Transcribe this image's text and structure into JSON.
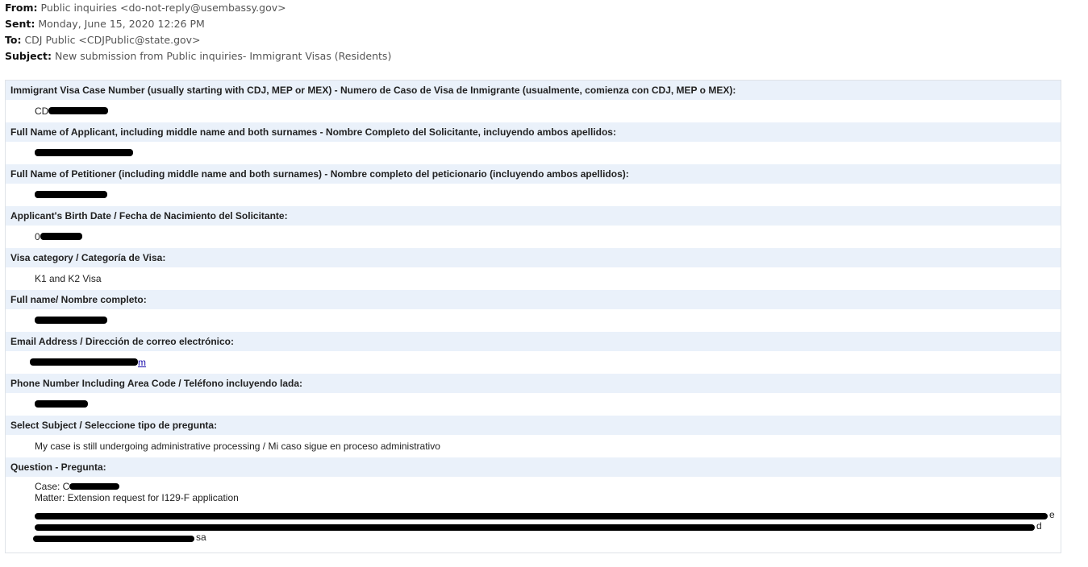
{
  "email_header": {
    "from_label": "From:",
    "from_value": "Public inquiries <do-not-reply@usembassy.gov>",
    "sent_label": "Sent:",
    "sent_value": "Monday, June 15, 2020 12:26 PM",
    "to_label": "To:",
    "to_value": "CDJ Public <CDJPublic@state.gov>",
    "subject_label": "Subject:",
    "subject_value": "New submission from Public inquiries- Immigrant Visas (Residents)"
  },
  "form": {
    "fields": [
      {
        "label": "Immigrant Visa Case Number (usually starting with CDJ, MEP or MEX) - Numero de Caso de Visa de Inmigrante (usualmente, comienza con CDJ, MEP o MEX):",
        "value_visible": "CD"
      },
      {
        "label": "Full Name of Applicant, including middle name and both surnames - Nombre Completo del Solicitante, incluyendo ambos apellidos:",
        "value_visible": ""
      },
      {
        "label": "Full Name of Petitioner (including middle name and both surnames) - Nombre completo del peticionario (incluyendo ambos apellidos):",
        "value_visible": ""
      },
      {
        "label": "Applicant's Birth Date / Fecha de Nacimiento del Solicitante:",
        "value_visible": "0"
      },
      {
        "label": "Visa category / Categoría de Visa:",
        "value_visible": "K1 and K2 Visa"
      },
      {
        "label": "Full name/ Nombre completo:",
        "value_visible": ""
      },
      {
        "label": "Email Address / Dirección de correo electrónico:",
        "value_visible": "m"
      },
      {
        "label": "Phone Number Including Area Code / Teléfono incluyendo lada:",
        "value_visible": ""
      },
      {
        "label": "Select Subject / Seleccione tipo de pregunta:",
        "value_visible": "My case is still undergoing administrative processing / Mi caso sigue en proceso administrativo"
      },
      {
        "label": "Question - Pregunta:"
      }
    ],
    "question": {
      "case_prefix": "Case: C",
      "matter": "Matter: Extension request for I129-F application",
      "line1_tail": "e",
      "line2_tail": "d",
      "line3_tail": "sa"
    }
  }
}
